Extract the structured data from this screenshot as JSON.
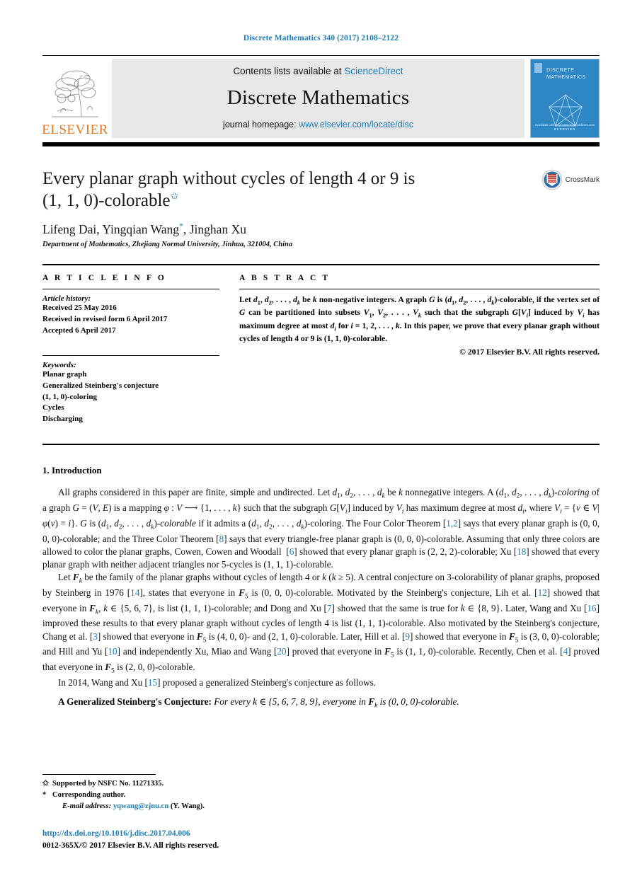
{
  "running_head": "Discrete Mathematics 340 (2017) 2108–2122",
  "masthead": {
    "publisher_name": "ELSEVIER",
    "contents_prefix": "Contents lists available at ",
    "contents_link": "ScienceDirect",
    "journal_name": "Discrete Mathematics",
    "homepage_prefix": "journal homepage: ",
    "homepage_url": "www.elsevier.com/locate/disc",
    "cover": {
      "title_line1": "DISCRETE",
      "title_line2": "MATHEMATICS",
      "foot_line1": "Available online at www.sciencedirect.com",
      "foot_line2": "ELSEVIER"
    }
  },
  "title_block": {
    "title_line1": "Every planar graph without cycles of length 4 or 9 is",
    "title_line2": "(1, 1, 0)-colorable",
    "title_footnote_mark": "✩",
    "authors_pre": "Lifeng Dai, Yingqian Wang",
    "authors_star": "*",
    "authors_post": ", Jinghan Xu",
    "affiliation": "Department of Mathematics, Zhejiang Normal University, Jinhua, 321004, China",
    "crossmark_label": "CrossMark"
  },
  "article_info": {
    "heading": "A R T I C L E   I N F O",
    "history_label": "Article history:",
    "history": [
      "Received 25 May 2016",
      "Received in revised form 6 April 2017",
      "Accepted 6 April 2017"
    ],
    "keywords_label": "Keywords:",
    "keywords": [
      "Planar graph",
      "Generalized Steinberg's conjecture",
      "(1, 1, 0)-coloring",
      "Cycles",
      "Discharging"
    ]
  },
  "abstract": {
    "heading": "A B S T R A C T",
    "text": "Let d1, d2, . . . , dk be k non-negative integers. A graph G is (d1, d2, . . . , dk)-colorable, if the vertex set of G can be partitioned into subsets V1, V2, . . . , Vk such that the subgraph G[Vi] induced by Vi has maximum degree at most di for i = 1, 2, . . . , k. In this paper, we prove that every planar graph without cycles of length 4 or 9 is (1, 1, 0)-colorable.",
    "copyright": "© 2017 Elsevier B.V. All rights reserved."
  },
  "body": {
    "section_number": "1.",
    "section_title": "Introduction",
    "paragraph1": "All graphs considered in this paper are finite, simple and undirected. Let d1, d2, . . . , dk be k nonnegative integers. A (d1, d2, . . . , dk)-coloring of a graph G = (V, E) is a mapping φ : V ⟶ {1, . . . , k} such that the subgraph G[Vi] induced by Vi has maximum degree at most di, where Vi = {v ∈ V|φ(v) = i}. G is (d1, d2, . . . , dk)-colorable if it admits a (d1, d2, . . . , dk)-coloring. The Four Color Theorem [1,2] says that every planar graph is (0, 0, 0, 0)-colorable; and the Three Color Theorem [8] says that every triangle-free planar graph is (0, 0, 0)-colorable. Assuming that only three colors are allowed to color the planar graphs, Cowen, Cowen and Woodall [6] showed that every planar graph is (2, 2, 2)-colorable; Xu [18] showed that every planar graph with neither adjacent triangles nor 5-cycles is (1, 1, 1)-colorable.",
    "paragraph2": "Let Fk be the family of the planar graphs without cycles of length 4 or k (k ≥ 5). A central conjecture on 3-colorability of planar graphs, proposed by Steinberg in 1976 [14], states that everyone in F5 is (0, 0, 0)-colorable. Motivated by the Steinberg's conjecture, Lih et al. [12] showed that everyone in Fk, k ∈ {5, 6, 7}, is list (1, 1, 1)-colorable; and Dong and Xu [7] showed that the same is true for k ∈ {8, 9}. Later, Wang and Xu [16] improved these results to that every planar graph without cycles of length 4 is list (1, 1, 1)-colorable. Also motivated by the Steinberg's conjecture, Chang et al. [3] showed that everyone in F5 is (4, 0, 0)- and (2, 1, 0)-colorable. Later, Hill et al. [9] showed that everyone in F5 is (3, 0, 0)-colorable; and Hill and Yu [10] and independently Xu, Miao and Wang [20] proved that everyone in F5 is (1, 1, 0)-colorable. Recently, Chen et al. [4] proved that everyone in F5 is (2, 0, 0)-colorable.",
    "paragraph3": "In 2014, Wang and Xu [15] proposed a generalized Steinberg's conjecture as follows.",
    "conjecture_label": "A Generalized Steinberg's Conjecture:",
    "conjecture_text": "For every k ∈ {5, 6, 7, 8, 9}, everyone in Fk is (0, 0, 0)-colorable."
  },
  "footnotes": {
    "funding_mark": "✩",
    "funding_text": "Supported by NSFC No. 11271335.",
    "corresponding_mark": "*",
    "corresponding_text": "Corresponding author.",
    "email_label": "E-mail address:",
    "email_link": "yqwang@zjnu.cn",
    "email_suffix": "(Y. Wang).",
    "doi": "http://dx.doi.org/10.1016/j.disc.2017.04.006",
    "issn": "0012-365X/© 2017 Elsevier B.V. All rights reserved."
  },
  "colors": {
    "link": "#1a7cb8",
    "elsevier_orange": "#E87722",
    "cover_blue": "#2f86c5",
    "masthead_gray": "#e8e8e8"
  }
}
